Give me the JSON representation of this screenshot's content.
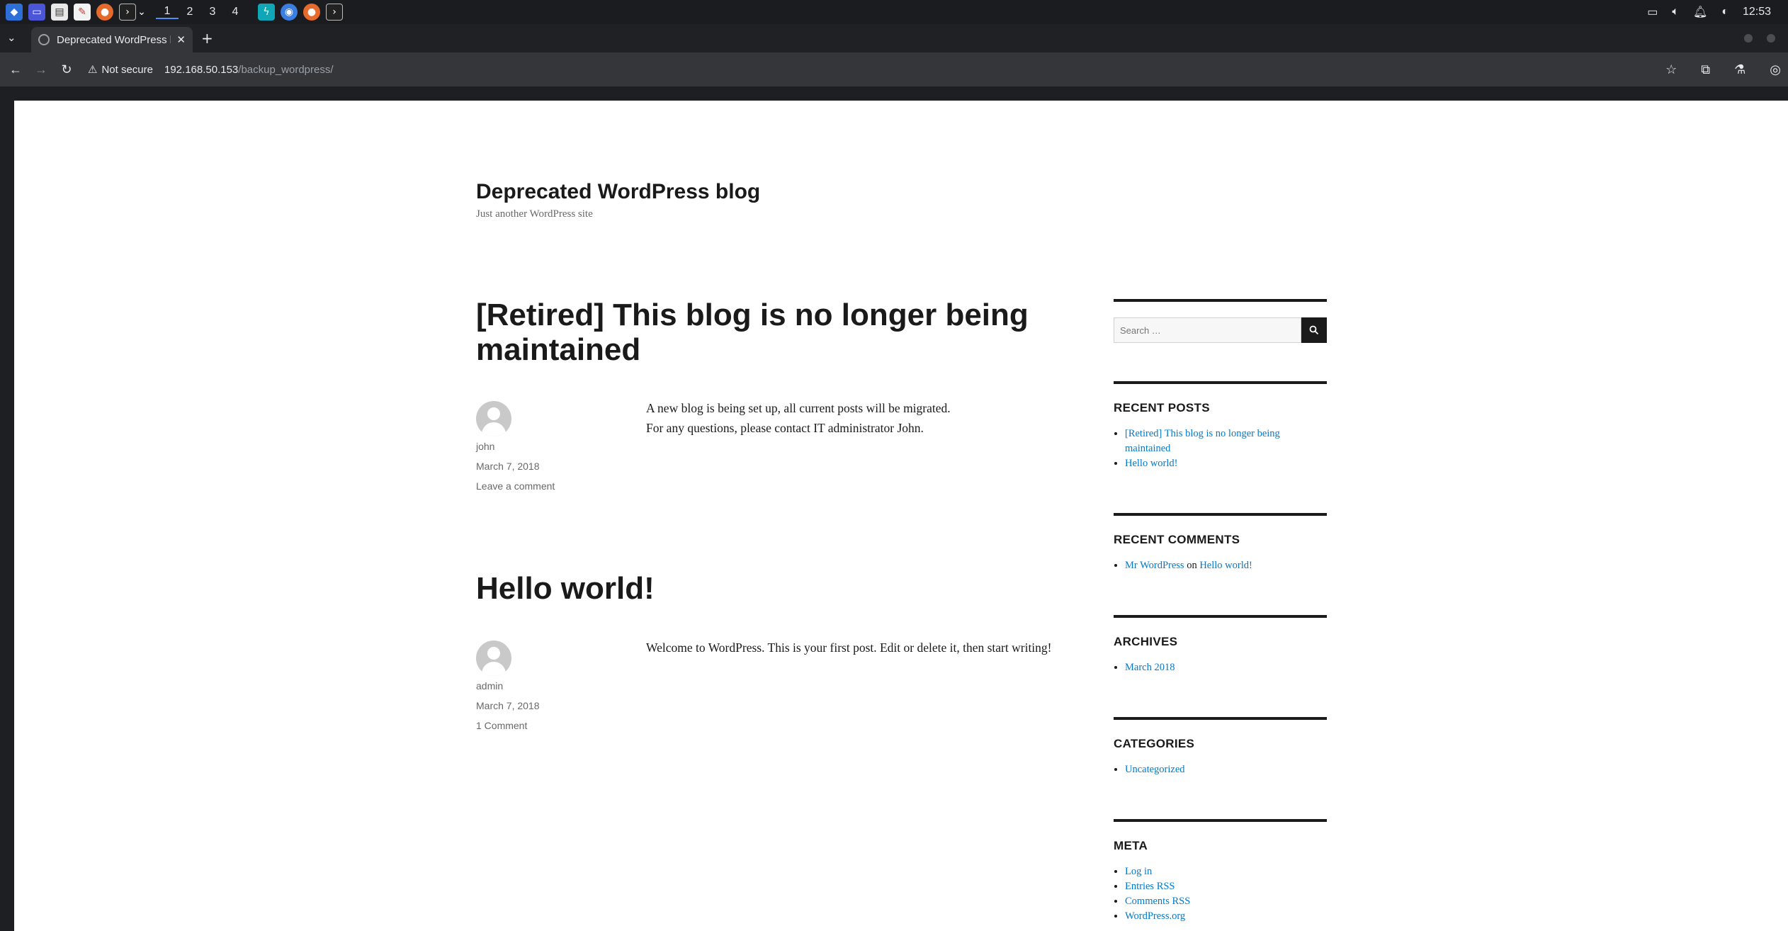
{
  "taskbar": {
    "workspaces": [
      "1",
      "2",
      "3",
      "4"
    ],
    "clock": "12:53"
  },
  "browser": {
    "tab_title": "Deprecated WordPress b",
    "security_label": "Not secure",
    "url_host": "192.168.50.153",
    "url_path": "/backup_wordpress/"
  },
  "site": {
    "title": "Deprecated WordPress blog",
    "description": "Just another WordPress site"
  },
  "posts": [
    {
      "title": "[Retired] This blog is no longer being maintained",
      "author": "john",
      "date": "March 7, 2018",
      "comments": "Leave a comment",
      "content_line1": "A new blog is being set up, all current posts will be migrated.",
      "content_line2": "For any questions, please contact IT administrator John."
    },
    {
      "title": "Hello world!",
      "author": "admin",
      "date": "March 7, 2018",
      "comments": "1 Comment",
      "content": "Welcome to WordPress. This is your first post. Edit or delete it, then start writing!"
    }
  ],
  "sidebar": {
    "search_placeholder": "Search …",
    "recent_posts": {
      "heading": "RECENT POSTS",
      "items": [
        "[Retired] This blog is no longer being maintained",
        "Hello world!"
      ]
    },
    "recent_comments": {
      "heading": "RECENT COMMENTS",
      "author": "Mr WordPress",
      "on": "on",
      "post": "Hello world!"
    },
    "archives": {
      "heading": "ARCHIVES",
      "items": [
        "March 2018"
      ]
    },
    "categories": {
      "heading": "CATEGORIES",
      "items": [
        "Uncategorized"
      ]
    },
    "meta": {
      "heading": "META",
      "items": [
        "Log in",
        "Entries RSS",
        "Comments RSS",
        "WordPress.org"
      ]
    }
  }
}
